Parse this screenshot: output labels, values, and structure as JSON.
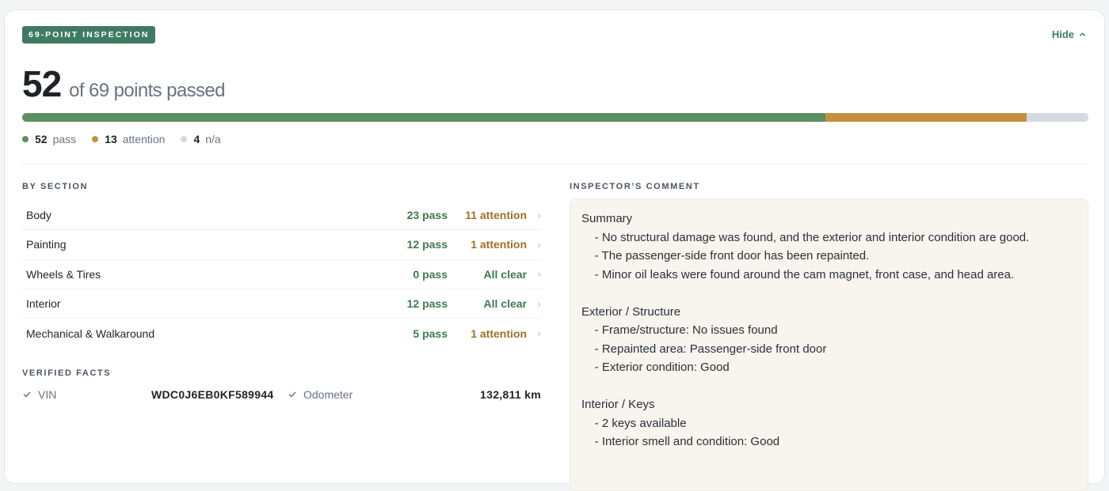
{
  "header": {
    "badge": "69-POINT INSPECTION",
    "hide_label": "Hide",
    "hide_icon": "chevron-up-icon"
  },
  "score": {
    "passed": "52",
    "rest": "of 69 points passed"
  },
  "progress": {
    "total": 69,
    "segments": [
      {
        "key": "pass",
        "value": 52,
        "color": "#5a8f62"
      },
      {
        "key": "attention",
        "value": 13,
        "color": "#c3913e"
      },
      {
        "key": "na",
        "value": 4,
        "color": "#d5d9e0"
      }
    ]
  },
  "legend": [
    {
      "count": "52",
      "label": "pass",
      "color": "#5a8f62"
    },
    {
      "count": "13",
      "label": "attention",
      "color": "#c3913e"
    },
    {
      "count": "4",
      "label": "n/a",
      "color": "#d5d9e0"
    }
  ],
  "by_section": {
    "title": "BY SECTION",
    "rows": [
      {
        "name": "Body",
        "pass": "23 pass",
        "status": "11 attention",
        "status_color": "#9a7324"
      },
      {
        "name": "Painting",
        "pass": "12 pass",
        "status": "1 attention",
        "status_color": "#9a7324"
      },
      {
        "name": "Wheels & Tires",
        "pass": "0 pass",
        "status": "All clear",
        "status_color": "#3f7a4e"
      },
      {
        "name": "Interior",
        "pass": "12 pass",
        "status": "All clear",
        "status_color": "#3f7a4e"
      },
      {
        "name": "Mechanical & Walkaround",
        "pass": "5 pass",
        "status": "1 attention",
        "status_color": "#9a7324"
      }
    ]
  },
  "verified_facts": {
    "title": "VERIFIED FACTS",
    "vin_label": "VIN",
    "vin_value": "WDC0J6EB0KF589944",
    "odometer_label": "Odometer",
    "odometer_value": "132,811 km"
  },
  "comment": {
    "title": "INSPECTOR’S COMMENT",
    "lines": [
      "Summary",
      "    - No structural damage was found, and the exterior and interior condition are good.",
      "    - The passenger-side front door has been repainted.",
      "    - Minor oil leaks were found around the cam magnet, front case, and head area.",
      "",
      "Exterior / Structure",
      "    - Frame/structure: No issues found",
      "    - Repainted area: Passenger-side front door",
      "    - Exterior condition: Good",
      "",
      "Interior / Keys",
      "    - 2 keys available",
      "    - Interior smell and condition: Good"
    ]
  }
}
